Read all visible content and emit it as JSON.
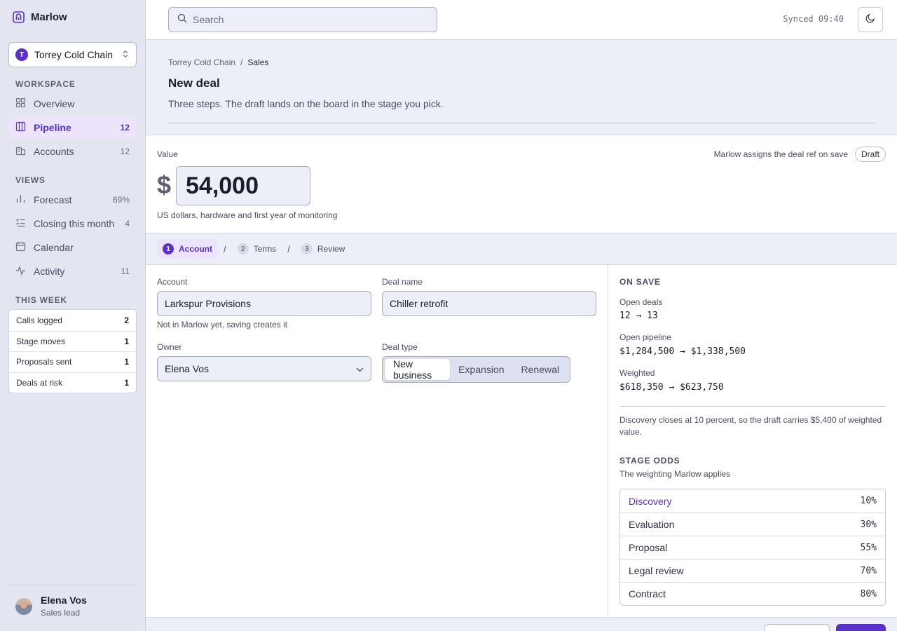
{
  "app": {
    "name": "Marlow",
    "accent": "#5b2fc9"
  },
  "org": {
    "initial": "T",
    "name": "Torrey Cold Chain"
  },
  "sidebar": {
    "workspace_heading": "WORKSPACE",
    "workspace_items": [
      {
        "label": "Overview",
        "count": "",
        "icon": "grid-icon"
      },
      {
        "label": "Pipeline",
        "count": "12",
        "icon": "columns-icon",
        "active": true
      },
      {
        "label": "Accounts",
        "count": "12",
        "icon": "building-icon"
      }
    ],
    "views_heading": "VIEWS",
    "views_items": [
      {
        "label": "Forecast",
        "count": "69%",
        "icon": "bar-chart-icon"
      },
      {
        "label": "Closing this month",
        "count": "4",
        "icon": "checklist-icon"
      },
      {
        "label": "Calendar",
        "count": "",
        "icon": "calendar-icon"
      },
      {
        "label": "Activity",
        "count": "11",
        "icon": "pulse-icon"
      }
    ],
    "week_heading": "THIS WEEK",
    "week_stats": [
      {
        "label": "Calls logged",
        "value": "2"
      },
      {
        "label": "Stage moves",
        "value": "1"
      },
      {
        "label": "Proposals sent",
        "value": "1"
      },
      {
        "label": "Deals at risk",
        "value": "1"
      }
    ],
    "user": {
      "name": "Elena Vos",
      "role": "Sales lead"
    }
  },
  "topbar": {
    "search_placeholder": "Search",
    "synced": "Synced 09:40"
  },
  "header": {
    "breadcrumb": [
      "Torrey Cold Chain",
      "/",
      "Sales"
    ],
    "title": "New deal",
    "subtitle": "Three steps. The draft lands on the board in the stage you pick."
  },
  "value": {
    "label": "Value",
    "currency": "$",
    "amount": "54,000",
    "help": "US dollars, hardware and first year of monitoring",
    "ref_note": "Marlow assigns the deal ref on save",
    "status": "Draft"
  },
  "steps": [
    {
      "num": "1",
      "label": "Account",
      "active": true
    },
    {
      "num": "2",
      "label": "Terms"
    },
    {
      "num": "3",
      "label": "Review"
    }
  ],
  "step_separator": "/",
  "form": {
    "account_label": "Account",
    "account_value": "Larkspur Provisions",
    "account_help": "Not in Marlow yet, saving creates it",
    "deal_name_label": "Deal name",
    "deal_name_value": "Chiller retrofit",
    "owner_label": "Owner",
    "owner_value": "Elena Vos",
    "deal_type_label": "Deal type",
    "deal_type_options": [
      "New business",
      "Expansion",
      "Renewal"
    ],
    "deal_type_selected": "New business"
  },
  "on_save": {
    "heading": "ON SAVE",
    "open_deals_label": "Open deals",
    "open_deals_value": "12 → 13",
    "open_pipeline_label": "Open pipeline",
    "open_pipeline_value": "$1,284,500 → $1,338,500",
    "weighted_label": "Weighted",
    "weighted_value": "$618,350 → $623,750",
    "note": "Discovery closes at 10 percent, so the draft carries $5,400 of weighted value."
  },
  "stage_odds": {
    "heading": "STAGE ODDS",
    "subtitle": "The weighting Marlow applies",
    "rows": [
      {
        "stage": "Discovery",
        "pct": "10%",
        "highlight": true
      },
      {
        "stage": "Evaluation",
        "pct": "30%"
      },
      {
        "stage": "Proposal",
        "pct": "55%"
      },
      {
        "stage": "Legal review",
        "pct": "70%"
      },
      {
        "stage": "Contract",
        "pct": "80%"
      }
    ]
  }
}
